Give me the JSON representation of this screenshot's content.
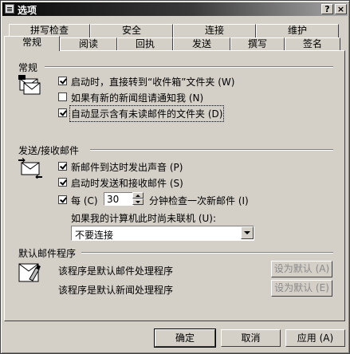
{
  "window": {
    "title": "选项",
    "help_glyph": "?",
    "close_glyph": "×"
  },
  "tabs": {
    "row_top": [
      "拼写检查",
      "安全",
      "连接",
      "维护"
    ],
    "row_bottom": [
      "常规",
      "阅读",
      "回执",
      "发送",
      "撰写",
      "签名"
    ],
    "active": "常规"
  },
  "general": {
    "heading": "常规",
    "options": [
      {
        "label": "启动时，直接转到“收件箱”文件夹 (W)",
        "checked": true
      },
      {
        "label": "如果有新的新闻组请通知我 (N)",
        "checked": false
      },
      {
        "label": "自动显示含有未读邮件的文件夹 (D)",
        "checked": true
      }
    ]
  },
  "send_receive": {
    "heading": "发送/接收邮件",
    "options": [
      {
        "label": "新邮件到达时发出声音 (P)",
        "checked": true
      },
      {
        "label": "启动时发送和接收邮件 (S)",
        "checked": true
      }
    ],
    "every": {
      "checked": true,
      "label": "每 (C)",
      "value": "30",
      "suffix": "分钟检查一次新邮件 (I)"
    },
    "offline_label": "如果我的计算机此时尚未联机 (U):",
    "offline_select": "不要连接"
  },
  "defaults": {
    "heading": "默认邮件程序",
    "mail_text": "该程序是默认邮件处理程序",
    "news_text": "该程序是默认新闻处理程序",
    "mail_button": "设为默认 (A)",
    "news_button": "设为默认 (E)"
  },
  "footer": {
    "ok": "确定",
    "cancel": "取消",
    "apply": "应用 (A)"
  },
  "colors": {
    "face": "#d4d0c8",
    "title_dark": "#0a0a0a",
    "title_light": "#a8a8a8"
  }
}
